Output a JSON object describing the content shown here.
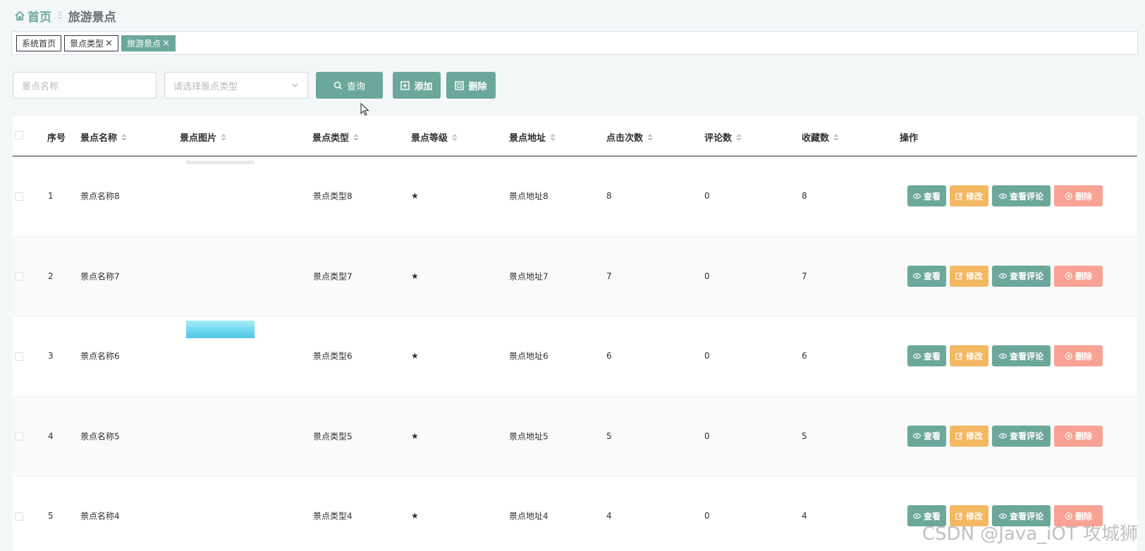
{
  "breadcrumb": {
    "home": "首页",
    "separator": "Ξ",
    "current": "旅游景点"
  },
  "tags": [
    {
      "label": "系统首页",
      "closable": false,
      "active": false
    },
    {
      "label": "景点类型",
      "closable": true,
      "active": false
    },
    {
      "label": "旅游景点",
      "closable": true,
      "active": true
    }
  ],
  "search": {
    "name_placeholder": "景点名称",
    "type_placeholder": "请选择景点类型",
    "search_label": "查询",
    "add_label": "添加",
    "delete_label": "删除"
  },
  "table": {
    "headers": {
      "index": "序号",
      "name": "景点名称",
      "image": "景点图片",
      "type": "景点类型",
      "level": "景点等级",
      "address": "景点地址",
      "clicks": "点击次数",
      "comments": "评论数",
      "favorites": "收藏数",
      "actions": "操作"
    },
    "action_labels": {
      "view": "查看",
      "edit": "修改",
      "comments": "查看评论",
      "delete": "删除"
    },
    "rows": [
      {
        "index": "1",
        "name": "景点名称8",
        "type": "景点类型8",
        "level": "★",
        "address": "景点地址8",
        "clicks": "8",
        "comments": "0",
        "favorites": "8",
        "image": "gray"
      },
      {
        "index": "2",
        "name": "景点名称7",
        "type": "景点类型7",
        "level": "★",
        "address": "景点地址7",
        "clicks": "7",
        "comments": "0",
        "favorites": "7",
        "image": "none"
      },
      {
        "index": "3",
        "name": "景点名称6",
        "type": "景点类型6",
        "level": "★",
        "address": "景点地址6",
        "clicks": "6",
        "comments": "0",
        "favorites": "6",
        "image": "sky"
      },
      {
        "index": "4",
        "name": "景点名称5",
        "type": "景点类型5",
        "level": "★",
        "address": "景点地址5",
        "clicks": "5",
        "comments": "0",
        "favorites": "5",
        "image": "none"
      },
      {
        "index": "5",
        "name": "景点名称4",
        "type": "景点类型4",
        "level": "★",
        "address": "景点地址4",
        "clicks": "4",
        "comments": "0",
        "favorites": "4",
        "image": "none"
      }
    ]
  },
  "watermark": "CSDN @Java_iOT 攻城狮",
  "colors": {
    "primary": "#6ca79c",
    "warning": "#f2b862",
    "danger": "#f7a293"
  }
}
